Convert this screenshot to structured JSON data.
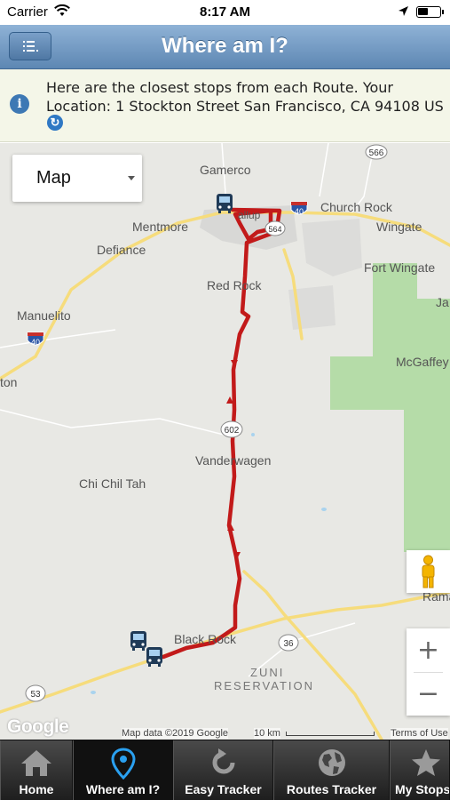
{
  "status_bar": {
    "carrier": "Carrier",
    "time": "8:17 AM",
    "battery_level": 0.45
  },
  "header": {
    "title": "Where am I?",
    "menu_icon": "list-icon"
  },
  "info": {
    "text_line1": "Here are the closest stops from each Route. Your",
    "text_line2": "Location: 1 Stockton Street San Francisco, CA 94108 US",
    "info_icon": "i",
    "refresh_icon": "refresh-icon"
  },
  "map": {
    "type_selector": {
      "label": "Map"
    },
    "labels": {
      "gamerco": "Gamerco",
      "church_rock": "Church Rock",
      "mentmore": "Mentmore",
      "gallup": "allup",
      "wingate": "Wingate",
      "defiance": "Defiance",
      "fort_wingate": "Fort Wingate",
      "ja": "Ja",
      "red_rock": "Red Rock",
      "manuelito": "Manuelito",
      "mcgaffey": "McGaffey",
      "ton": "ton",
      "vanderwagen": "Vanderwagen",
      "chi_chil_tah": "Chi Chil Tah",
      "rama": "Rama",
      "black_rock": "Black Rock",
      "zuni": "ZUNI",
      "reservation": "RESERVATION"
    },
    "shields": {
      "i40_a": "40",
      "i40_b": "40",
      "r566": "566",
      "r564": "564",
      "r602": "602",
      "r36": "36",
      "r53": "53"
    },
    "zoom_in": "+",
    "zoom_out": "−",
    "google_logo": "Google",
    "attribution": "Map data ©2019 Google",
    "scale": "10 km",
    "terms": "Terms of Use",
    "route_color": "#c21a1a",
    "water_color": "#a9d3ee",
    "park_color": "#b5dca8"
  },
  "tabs": [
    {
      "label": "Home",
      "icon": "home-icon"
    },
    {
      "label": "Where am I?",
      "icon": "location-pin-icon",
      "active": true
    },
    {
      "label": "Easy Tracker",
      "icon": "refresh-arrow-icon"
    },
    {
      "label": "Routes Tracker",
      "icon": "globe-icon"
    },
    {
      "label": "My Stops",
      "icon": "star-icon"
    }
  ]
}
